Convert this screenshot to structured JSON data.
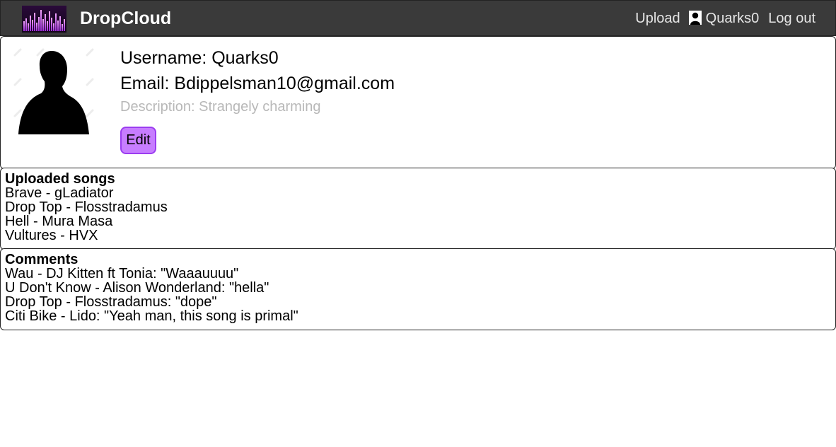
{
  "app": {
    "brand": "DropCloud",
    "accent": "#c77dff",
    "topbar_color": "#3a3a3a"
  },
  "nav": {
    "upload_label": "Upload",
    "user_icon": "user-icon",
    "username": "Quarks0",
    "logout_label": "Log out"
  },
  "profile": {
    "username_line": "Username: Quarks0",
    "email_line": "Email: Bdippelsman10@gmail.com",
    "description_line": "Description: Strangely charming",
    "edit_label": "Edit"
  },
  "uploaded": {
    "heading": "Uploaded songs",
    "songs": [
      "Brave - gLadiator",
      "Drop Top - Flosstradamus",
      "Hell - Mura Masa",
      "Vultures - HVX"
    ]
  },
  "comments": {
    "heading": "Comments",
    "items": [
      "Wau - DJ Kitten ft Tonia: \"Waaauuuu\"",
      "U Don't Know - Alison Wonderland: \"hella\"",
      "Drop Top - Flosstradamus: \"dope\"",
      "Citi Bike - Lido: \"Yeah man, this song is primal\""
    ]
  }
}
